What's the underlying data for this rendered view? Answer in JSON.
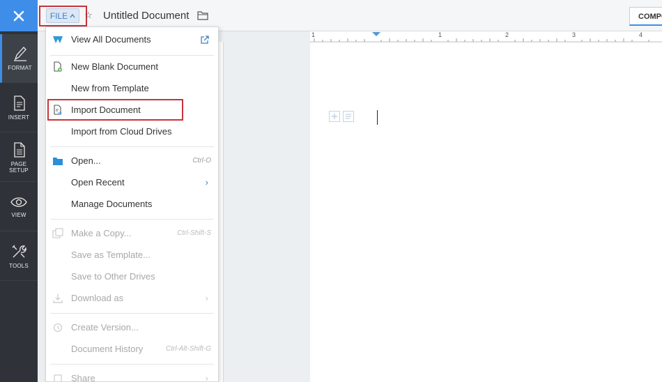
{
  "rail": {
    "items": [
      {
        "label": "FORMAT",
        "icon": "format-pen-icon"
      },
      {
        "label": "INSERT",
        "icon": "insert-icon"
      },
      {
        "label": "PAGE\nSETUP",
        "icon": "page-setup-icon"
      },
      {
        "label": "VIEW",
        "icon": "eye-icon"
      },
      {
        "label": "TOOLS",
        "icon": "tools-icon"
      }
    ]
  },
  "topbar": {
    "file_label": "FILE",
    "doc_title": "Untitled Document",
    "compose_label": "COMPO"
  },
  "ruler": {
    "marks": [
      "1",
      "1",
      "2",
      "3",
      "4"
    ]
  },
  "menu": {
    "view_all": "View All Documents",
    "new_blank": "New Blank Document",
    "new_template": "New from Template",
    "import_document": "Import Document",
    "import_cloud": "Import from Cloud Drives",
    "open": "Open...",
    "open_shortcut": "Ctrl-O",
    "open_recent": "Open Recent",
    "manage": "Manage Documents",
    "make_copy": "Make a Copy...",
    "make_copy_shortcut": "Ctrl-Shift-S",
    "save_template": "Save as Template...",
    "save_other": "Save to Other Drives",
    "download": "Download as",
    "create_version": "Create Version...",
    "doc_history": "Document History",
    "doc_history_shortcut": "Ctrl-Alt-Shift-G",
    "share": "Share"
  },
  "colors": {
    "accent": "#3e8ee9",
    "highlight": "#c8323a",
    "rail_bg": "#2f3339"
  }
}
